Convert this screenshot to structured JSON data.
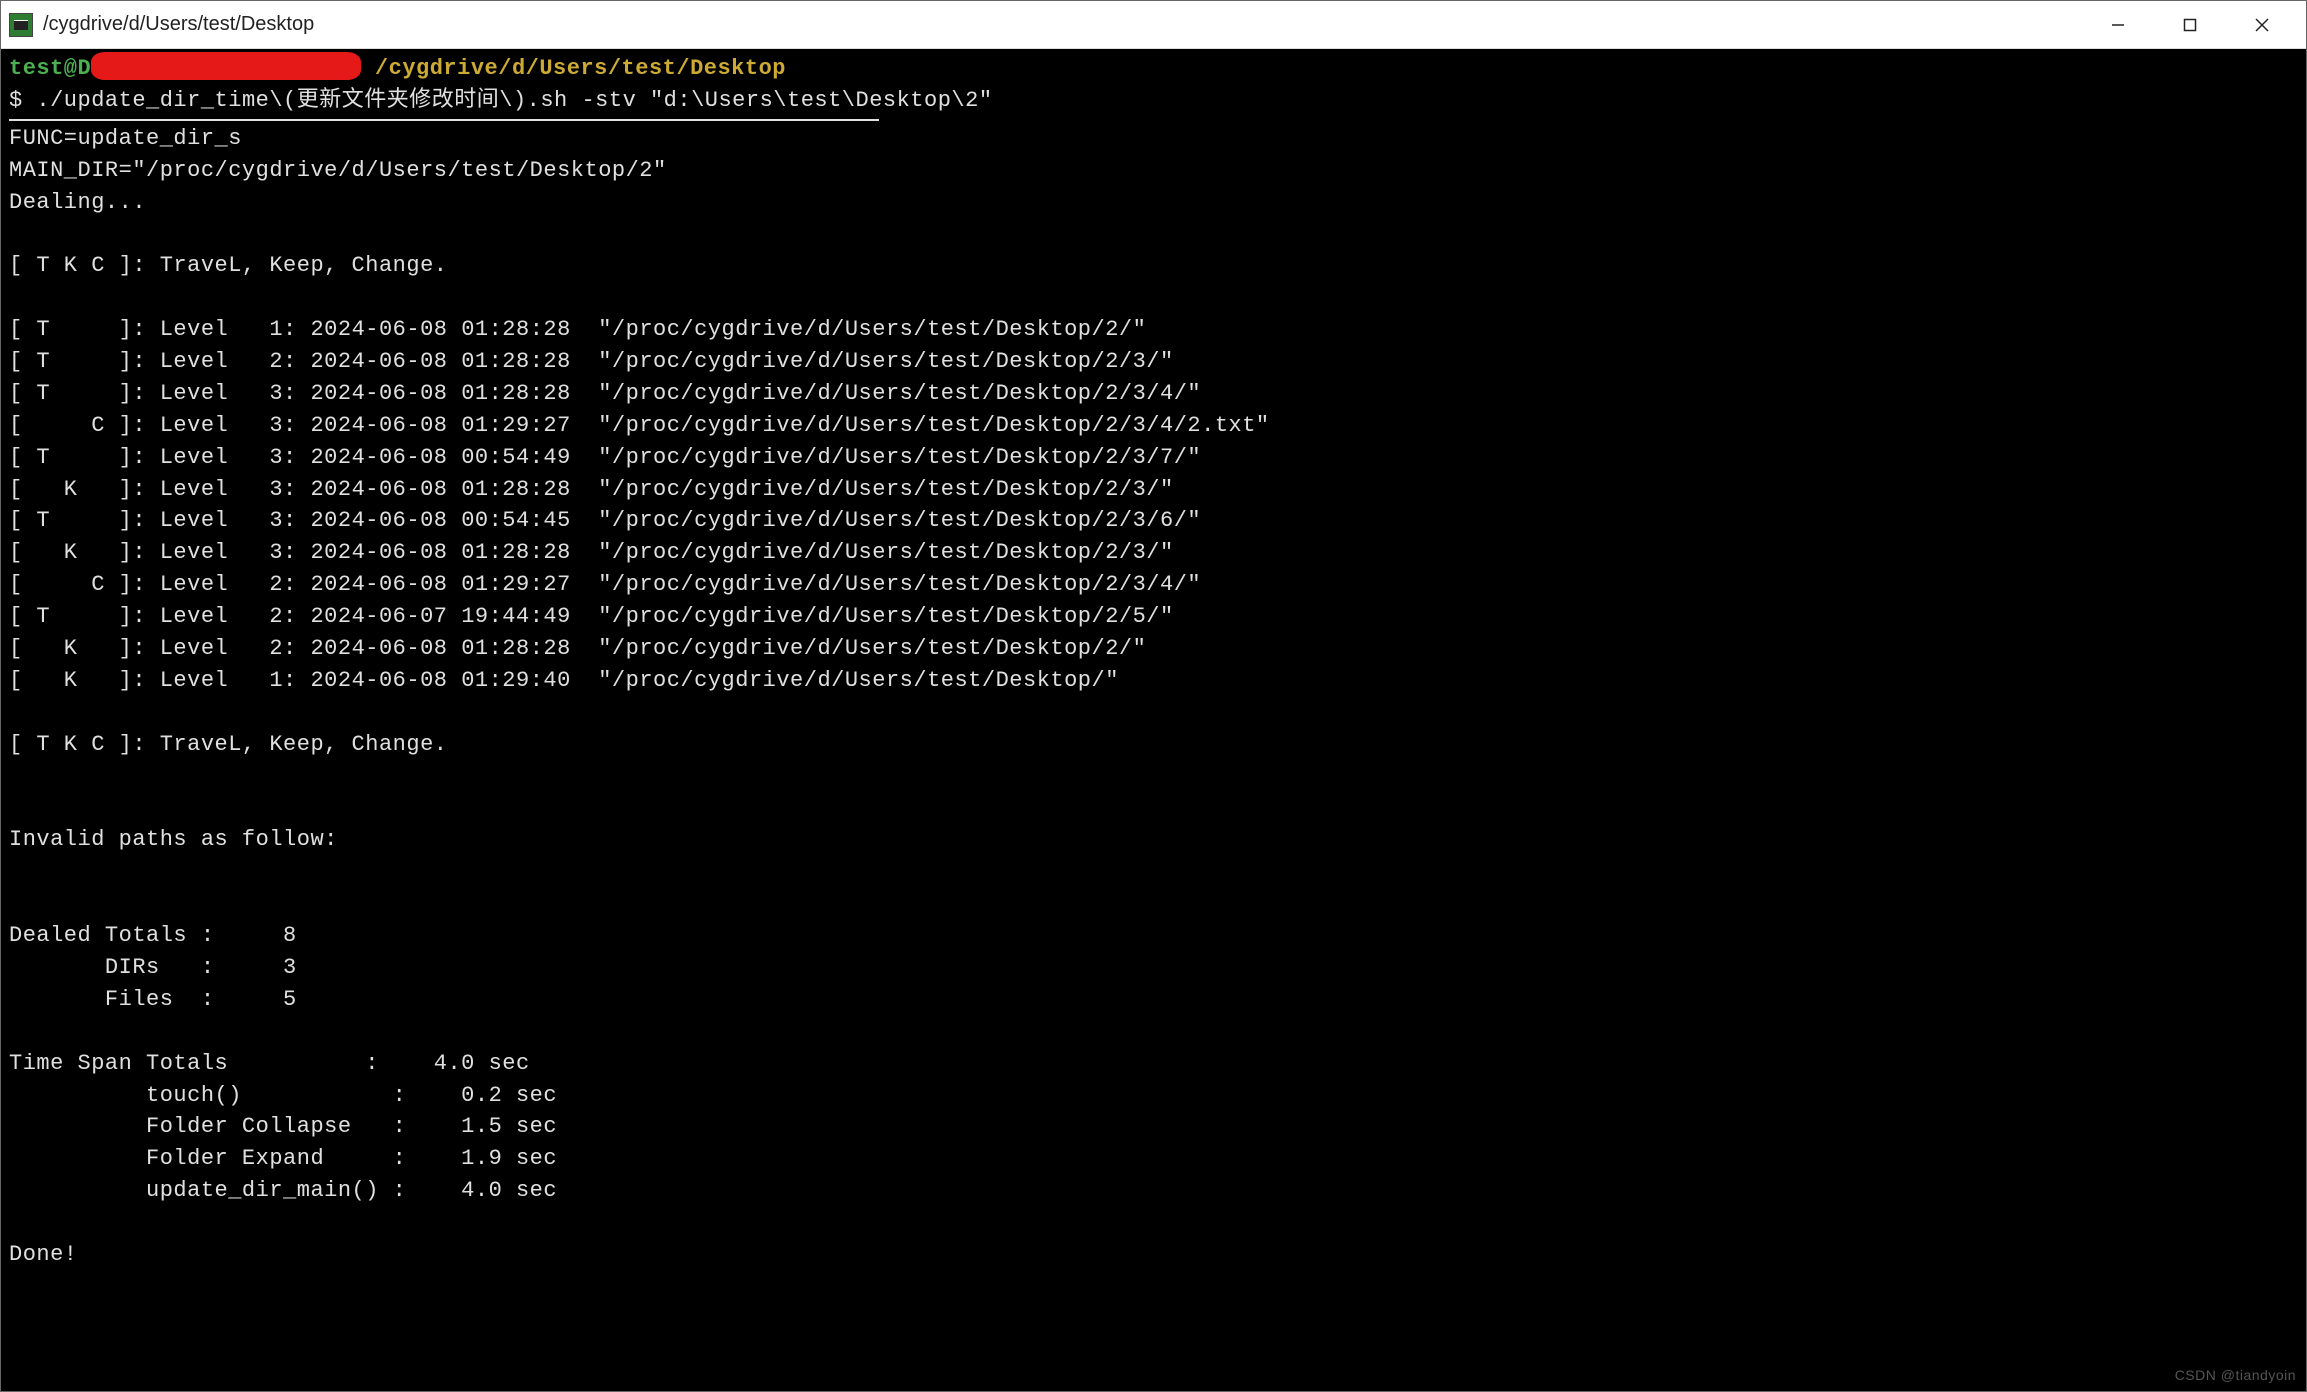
{
  "titlebar": {
    "title": "/cygdrive/d/Users/test/Desktop"
  },
  "prompt": {
    "user": "test@D",
    "path": "/cygdrive/d/Users/test/Desktop",
    "symbol": "$",
    "command": "./update_dir_time\\(更新文件夹修改时间\\).sh -stv \"d:\\Users\\test\\Desktop\\2\""
  },
  "output": {
    "func_line": "FUNC=update_dir_s",
    "main_dir_line": "MAIN_DIR=\"/proc/cygdrive/d/Users/test/Desktop/2\"",
    "dealing": "Dealing...",
    "legend": "[ T K C ]: TraveL, Keep, Change.",
    "rows": [
      {
        "tag": "[ T     ]:",
        "level": "Level   1:",
        "ts": "2024-06-08 01:28:28",
        "path": "\"/proc/cygdrive/d/Users/test/Desktop/2/\""
      },
      {
        "tag": "[ T     ]:",
        "level": "Level   2:",
        "ts": "2024-06-08 01:28:28",
        "path": "\"/proc/cygdrive/d/Users/test/Desktop/2/3/\""
      },
      {
        "tag": "[ T     ]:",
        "level": "Level   3:",
        "ts": "2024-06-08 01:28:28",
        "path": "\"/proc/cygdrive/d/Users/test/Desktop/2/3/4/\""
      },
      {
        "tag": "[     C ]:",
        "level": "Level   3:",
        "ts": "2024-06-08 01:29:27",
        "path": "\"/proc/cygdrive/d/Users/test/Desktop/2/3/4/2.txt\""
      },
      {
        "tag": "[ T     ]:",
        "level": "Level   3:",
        "ts": "2024-06-08 00:54:49",
        "path": "\"/proc/cygdrive/d/Users/test/Desktop/2/3/7/\""
      },
      {
        "tag": "[   K   ]:",
        "level": "Level   3:",
        "ts": "2024-06-08 01:28:28",
        "path": "\"/proc/cygdrive/d/Users/test/Desktop/2/3/\""
      },
      {
        "tag": "[ T     ]:",
        "level": "Level   3:",
        "ts": "2024-06-08 00:54:45",
        "path": "\"/proc/cygdrive/d/Users/test/Desktop/2/3/6/\""
      },
      {
        "tag": "[   K   ]:",
        "level": "Level   3:",
        "ts": "2024-06-08 01:28:28",
        "path": "\"/proc/cygdrive/d/Users/test/Desktop/2/3/\""
      },
      {
        "tag": "[     C ]:",
        "level": "Level   2:",
        "ts": "2024-06-08 01:29:27",
        "path": "\"/proc/cygdrive/d/Users/test/Desktop/2/3/4/\""
      },
      {
        "tag": "[ T     ]:",
        "level": "Level   2:",
        "ts": "2024-06-07 19:44:49",
        "path": "\"/proc/cygdrive/d/Users/test/Desktop/2/5/\""
      },
      {
        "tag": "[   K   ]:",
        "level": "Level   2:",
        "ts": "2024-06-08 01:28:28",
        "path": "\"/proc/cygdrive/d/Users/test/Desktop/2/\""
      },
      {
        "tag": "[   K   ]:",
        "level": "Level   1:",
        "ts": "2024-06-08 01:29:40",
        "path": "\"/proc/cygdrive/d/Users/test/Desktop/\""
      }
    ],
    "legend2": "[ T K C ]: TraveL, Keep, Change.",
    "invalid_header": "Invalid paths as follow:",
    "summary": {
      "dealed_totals": "Dealed Totals :     8",
      "dirs": "       DIRs   :     3",
      "files": "       Files  :     5"
    },
    "timing": {
      "total": "Time Span Totals          :    4.0 sec",
      "touch": "          touch()           :    0.2 sec",
      "collapse": "          Folder Collapse   :    1.5 sec",
      "expand": "          Folder Expand     :    1.9 sec",
      "main": "          update_dir_main() :    4.0 sec"
    },
    "done": "Done!"
  },
  "watermark": "CSDN @tiandyoin"
}
